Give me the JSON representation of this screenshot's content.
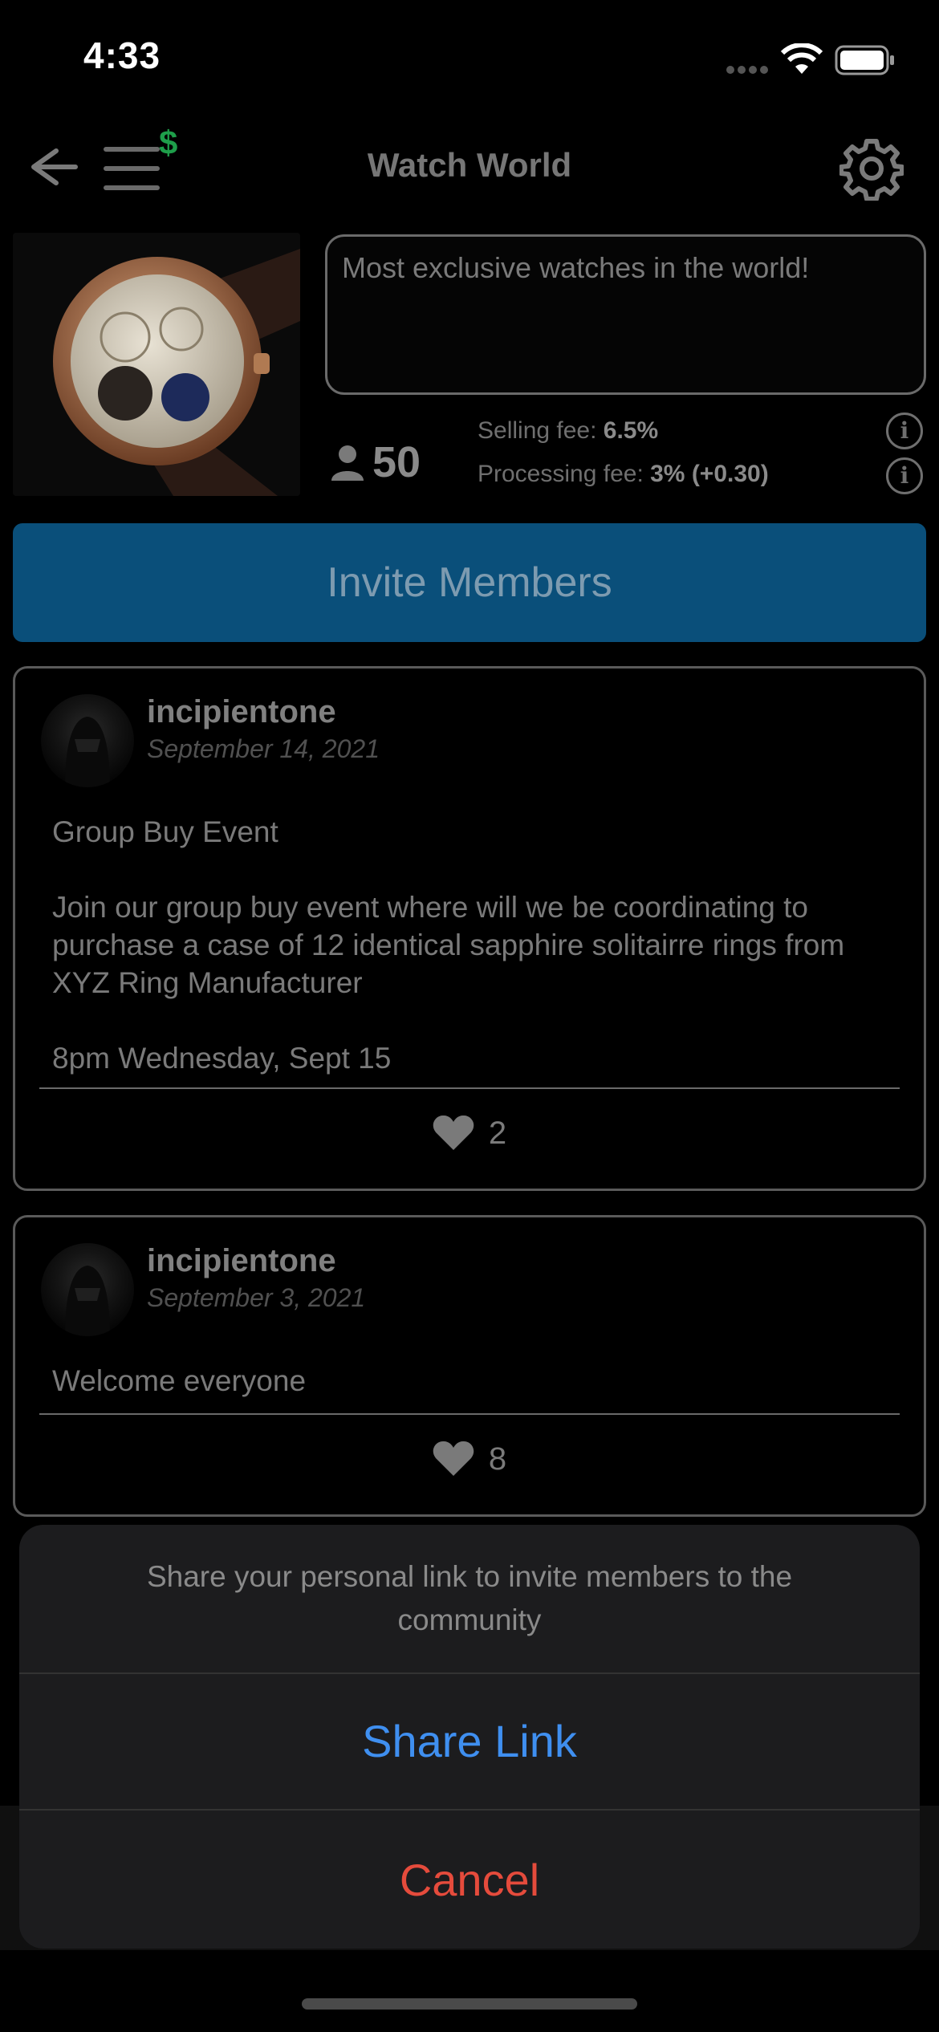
{
  "status_bar": {
    "time": "4:33"
  },
  "header": {
    "title": "Watch World"
  },
  "group": {
    "description": "Most exclusive watches in the world!",
    "member_count": "50",
    "selling_fee_label": "Selling fee: ",
    "selling_fee_value": "6.5%",
    "processing_fee_label": "Processing fee: ",
    "processing_fee_value": "3% (+0.30)"
  },
  "invite_button": "Invite Members",
  "posts": [
    {
      "username": "incipientone",
      "date": "September 14, 2021",
      "text": "Group Buy Event\n\nJoin our group buy event where will we be coordinating to purchase a case of 12 identical sapphire solitairre rings from XYZ Ring Manufacturer\n\n8pm Wednesday, Sept 15",
      "likes": "2"
    },
    {
      "username": "incipientone",
      "date": "September 3, 2021",
      "text": "Welcome everyone",
      "likes": "8"
    }
  ],
  "action_sheet": {
    "message": "Share your personal link to invite members to the community",
    "share_label": "Share Link",
    "cancel_label": "Cancel"
  },
  "colors": {
    "invite_bg": "#0a4f7a",
    "share": "#3f8ff0",
    "cancel": "#e54b3c",
    "dollar": "#1e9e4a"
  },
  "icons": [
    "back-arrow-icon",
    "menu-icon",
    "dollar-icon",
    "gear-icon",
    "person-icon",
    "info-icon",
    "heart-icon",
    "signal-icon",
    "wifi-icon",
    "battery-icon"
  ]
}
